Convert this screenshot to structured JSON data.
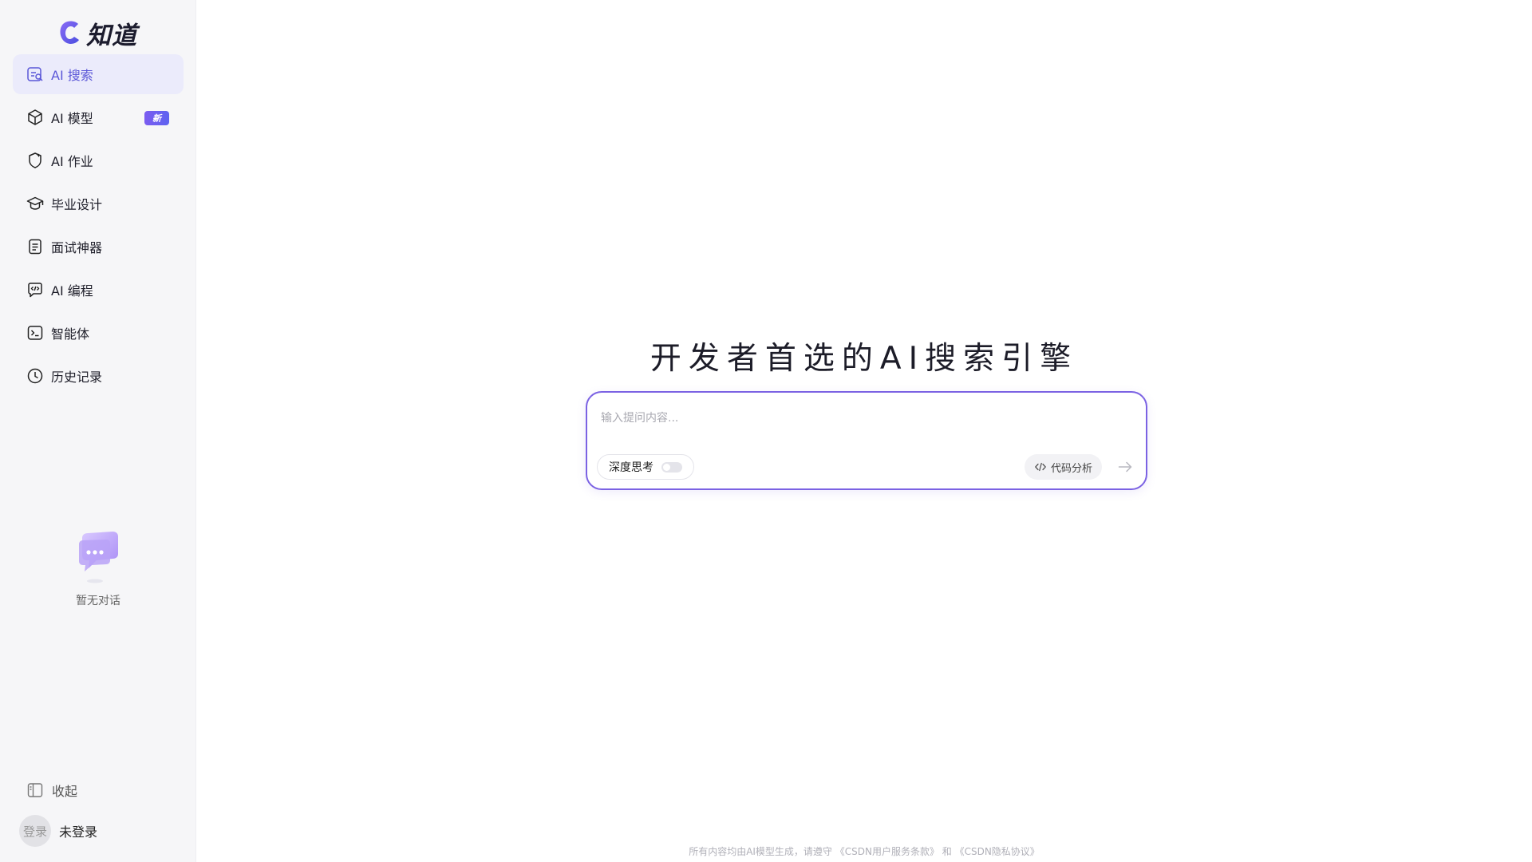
{
  "brand": {
    "name": "知道",
    "accent": "#6c5ce7"
  },
  "sidebar": {
    "items": [
      {
        "label": "AI 搜索",
        "icon": "ai-search-icon",
        "active": true
      },
      {
        "label": "AI 模型",
        "icon": "cube-icon",
        "badge": "新"
      },
      {
        "label": "AI 作业",
        "icon": "homework-icon"
      },
      {
        "label": "毕业设计",
        "icon": "graduation-cap-icon"
      },
      {
        "label": "面试神器",
        "icon": "document-icon"
      },
      {
        "label": "AI 编程",
        "icon": "code-chat-icon"
      },
      {
        "label": "智能体",
        "icon": "terminal-icon"
      },
      {
        "label": "历史记录",
        "icon": "clock-icon"
      }
    ],
    "empty_text": "暂无对话",
    "collapse_label": "收起",
    "user": {
      "avatar_text": "登录",
      "name": "未登录"
    }
  },
  "main": {
    "title": "开发者首选的AI搜索引擎",
    "search": {
      "placeholder": "输入提问内容...",
      "deep_think_label": "深度思考",
      "deep_think_on": false,
      "code_analysis_label": "代码分析"
    },
    "footer": "所有内容均由AI模型生成，请遵守 《CSDN用户服务条款》 和 《CSDN隐私协议》"
  }
}
